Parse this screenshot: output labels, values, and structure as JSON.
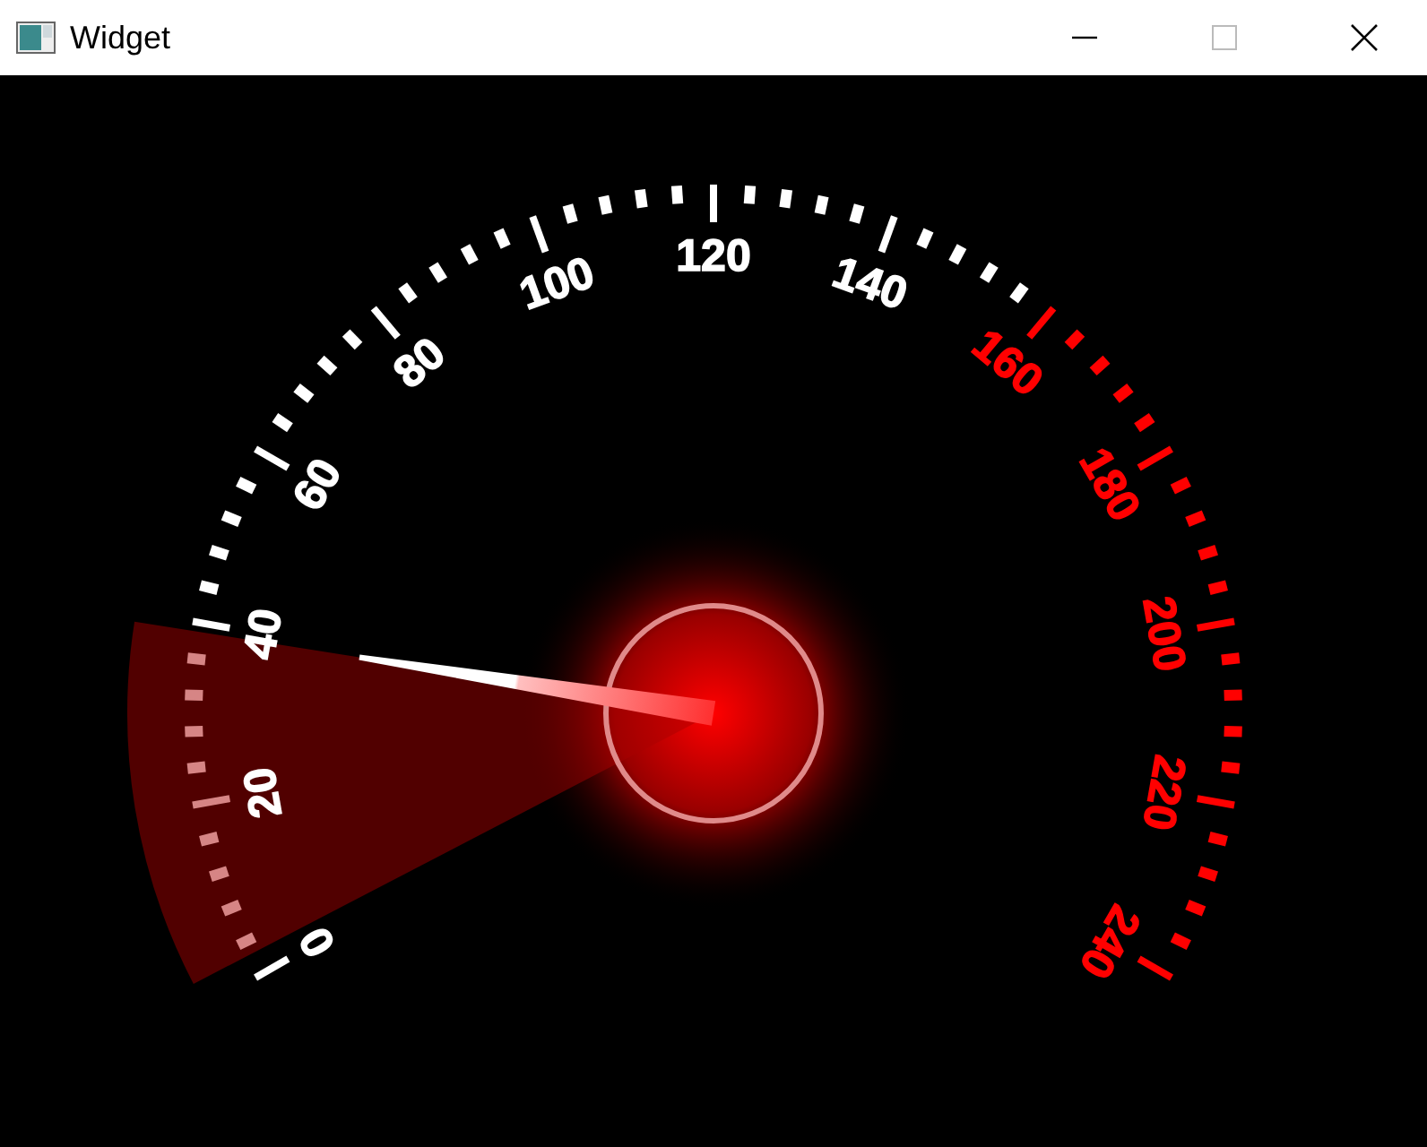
{
  "window": {
    "title": "Widget"
  },
  "gauge": {
    "level": 0.1625,
    "labels": [
      {
        "text": "0",
        "color": "#ffffff"
      },
      {
        "text": "20",
        "color": "#ffffff"
      },
      {
        "text": "40",
        "color": "#ffffff"
      },
      {
        "text": "60",
        "color": "#ffffff"
      },
      {
        "text": "80",
        "color": "#ffffff"
      },
      {
        "text": "100",
        "color": "#ffffff"
      },
      {
        "text": "120",
        "color": "#ffffff"
      },
      {
        "text": "140",
        "color": "#ffffff"
      },
      {
        "text": "160",
        "color": "#ff0000"
      },
      {
        "text": "180",
        "color": "#ff0000"
      },
      {
        "text": "200",
        "color": "#ff0000"
      },
      {
        "text": "220",
        "color": "#ff0000"
      },
      {
        "text": "240",
        "color": "#ff0000"
      }
    ]
  }
}
